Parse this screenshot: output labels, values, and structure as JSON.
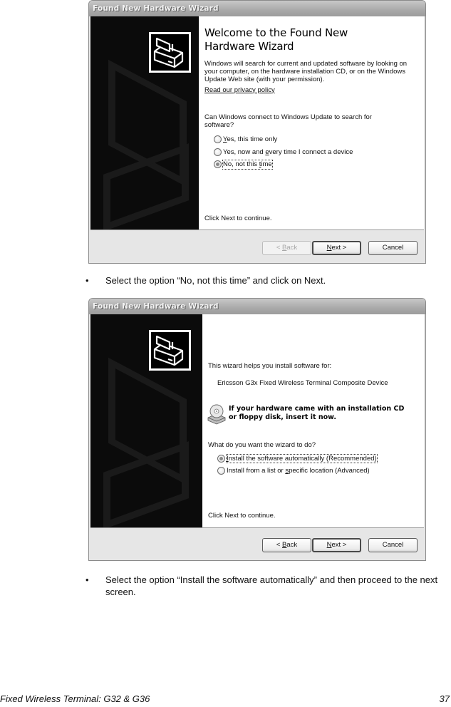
{
  "dialog1": {
    "title": "Found New Hardware Wizard",
    "heading_line1": "Welcome to the Found New",
    "heading_line2": "Hardware Wizard",
    "intro": "Windows will search for current and updated software by looking on your computer, on the hardware installation CD, or on the Windows Update Web site (with your permission).",
    "privacy_link": "Read our privacy policy",
    "question": "Can Windows connect to Windows Update to search for software?",
    "options": [
      {
        "pre": "",
        "key": "Y",
        "post": "es, this time only",
        "selected": false
      },
      {
        "pre": "Yes, now and ",
        "key": "e",
        "post": "very time I connect a device",
        "selected": false
      },
      {
        "pre": "No, not this ",
        "key": "t",
        "post": "ime",
        "selected": true
      }
    ],
    "continue_text": "Click Next to continue.",
    "buttons": {
      "back": {
        "pre": "< ",
        "key": "B",
        "post": "ack",
        "enabled": false
      },
      "next": {
        "pre": "",
        "key": "N",
        "post": "ext >",
        "enabled": true
      },
      "cancel": {
        "label": "Cancel",
        "enabled": true
      }
    }
  },
  "instruction1": "Select the option “No, not this time” and click on Next.",
  "dialog2": {
    "title": "Found New Hardware Wizard",
    "intro": "This wizard helps you install software for:",
    "device_name": "Ericsson G3x Fixed Wireless Terminal Composite Device",
    "cd_prompt_line1": "If your hardware came with an installation CD",
    "cd_prompt_line2": "or floppy disk, insert it now.",
    "question": "What do you want the wizard to do?",
    "options": [
      {
        "pre": "",
        "key": "I",
        "post": "nstall the software automatically (Recommended)",
        "selected": true
      },
      {
        "pre": "Install from a list or ",
        "key": "s",
        "post": "pecific location (Advanced)",
        "selected": false
      }
    ],
    "continue_text": "Click Next to continue.",
    "buttons": {
      "back": {
        "pre": "< ",
        "key": "B",
        "post": "ack",
        "enabled": true
      },
      "next": {
        "pre": "",
        "key": "N",
        "post": "ext >",
        "enabled": true
      },
      "cancel": {
        "label": "Cancel",
        "enabled": true
      }
    }
  },
  "instruction2": "Select the option “Install the software automatically” and then proceed to the next screen.",
  "bullet_glyph": "•",
  "footer": {
    "doc_title": "Fixed Wireless Terminal: G32 & G36",
    "page_number": "37"
  }
}
